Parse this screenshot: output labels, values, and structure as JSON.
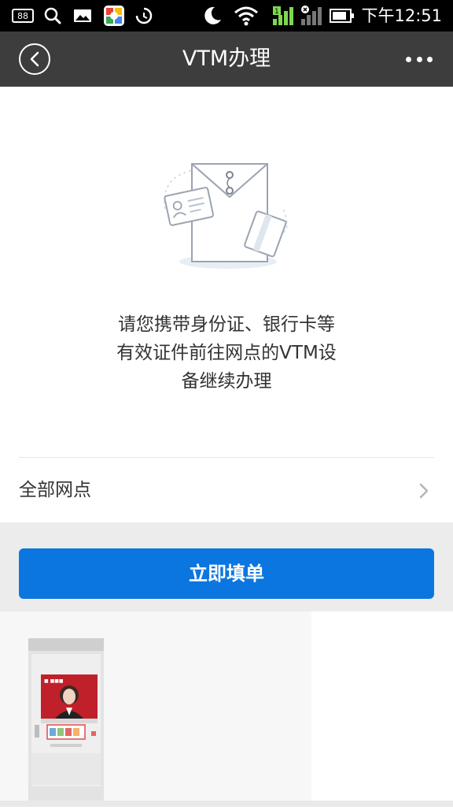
{
  "status_bar": {
    "time": "下午12:51",
    "battery_badge": "88",
    "icons": [
      "notification-88-icon",
      "search-icon",
      "image-icon",
      "app-icon",
      "sync-icon",
      "moon-icon",
      "wifi-icon",
      "signal-1-icon",
      "signal-off-icon",
      "battery-icon"
    ]
  },
  "nav": {
    "title": "VTM办理",
    "back_icon": "chevron-left-circle-icon",
    "more_icon": "more-dots-icon"
  },
  "illustration": {
    "name": "envelope-id-card-illustration"
  },
  "message": {
    "line1": "请您携带身份证、银行卡等",
    "line2": "有效证件前往网点的VTM设",
    "line3": "备继续办理"
  },
  "branches": {
    "label": "全部网点",
    "icon": "chevron-right-icon"
  },
  "action": {
    "button_label": "立即填单",
    "button_color": "#0b76e0"
  },
  "banner": {
    "name": "vtm-machine-image"
  }
}
